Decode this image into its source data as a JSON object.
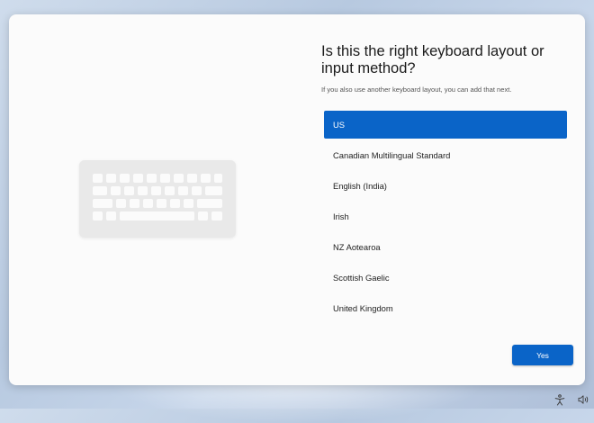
{
  "setup": {
    "title": "Is this the right keyboard layout or input method?",
    "subtitle": "If you also use another keyboard layout, you can add that next.",
    "layouts": [
      {
        "label": "US",
        "selected": true
      },
      {
        "label": "Canadian Multilingual Standard",
        "selected": false
      },
      {
        "label": "English (India)",
        "selected": false
      },
      {
        "label": "Irish",
        "selected": false
      },
      {
        "label": "NZ Aotearoa",
        "selected": false
      },
      {
        "label": "Scottish Gaelic",
        "selected": false
      },
      {
        "label": "United Kingdom",
        "selected": false
      }
    ],
    "yes_label": "Yes"
  },
  "tray": {
    "icons": [
      "accessibility-icon",
      "volume-icon"
    ]
  },
  "colors": {
    "accent": "#0a64c8",
    "card": "#fbfbfb",
    "keyboard_illustration": "#e9e9e9"
  }
}
